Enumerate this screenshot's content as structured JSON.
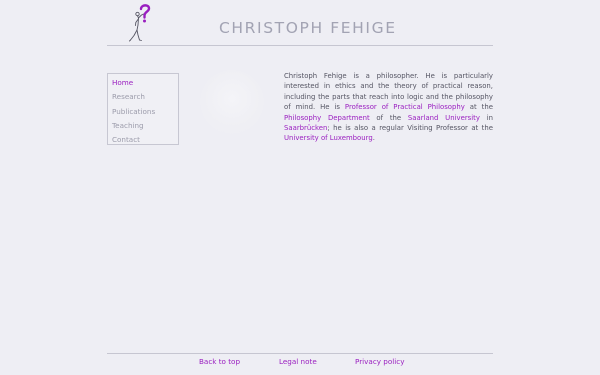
{
  "header": {
    "title": "CHRISTOPH FEHIGE",
    "logo_icon": "question-mark-figure-icon"
  },
  "nav": {
    "items": [
      {
        "label": "Home",
        "active": true
      },
      {
        "label": "Research",
        "active": false
      },
      {
        "label": "Publications",
        "active": false
      },
      {
        "label": "Teaching",
        "active": false
      },
      {
        "label": "Contact",
        "active": false
      }
    ]
  },
  "intro": {
    "t1": "Christoph Fehige is a philosopher. He is particularly interested in ethics and the theory of practical reason, including the parts that reach into logic and the philosophy of mind. He is ",
    "link_professor": "Professor of Practical Philosophy",
    "t2": " at the ",
    "link_department": "Philosophy Department",
    "t3": " of the ",
    "link_university": "Saarland University",
    "t4": " in ",
    "link_city": "Saarbrücken",
    "t5": "; he is also a regular Visiting Professor at the ",
    "link_luxembourg": "University of Luxembourg",
    "t6": "."
  },
  "footer": {
    "back_to_top": "Back to top",
    "legal_note": "Legal note",
    "privacy_policy": "Privacy policy"
  },
  "colors": {
    "background": "#eeeef4",
    "accent": "#9a1fc0",
    "title": "#a2a3b3",
    "text": "#555563",
    "nav_text": "#9c9cab"
  }
}
